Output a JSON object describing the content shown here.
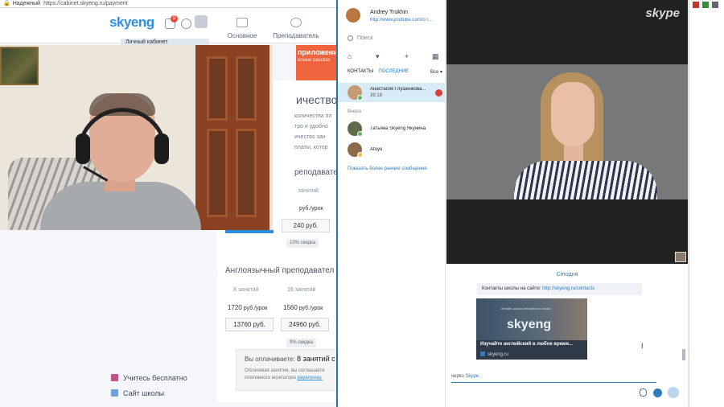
{
  "browser": {
    "secure_label": "Надежный",
    "url": "https://cabinet.skyeng.ru/payment",
    "logo": "skyeng",
    "notif_count": "9",
    "nav": [
      {
        "label": "Основное",
        "icon": "home-icon"
      },
      {
        "label": "Преподаватель",
        "icon": "teacher-icon"
      }
    ],
    "sidebar_active": "Личный кабинет",
    "promo_title": "приложени",
    "promo_sub": "есные рассказ",
    "section_title": "ичество з",
    "desc_lines": [
      "количества пл",
      "тро и удобно",
      "ичество зан",
      "платы, котор"
    ],
    "subhead1": "реподавател",
    "col_head1": "занятий",
    "rate1": "руб./урок",
    "price1": "240 руб.",
    "discount1": "10% скидка",
    "subhead2": "Англоязычный преподавател",
    "cols2": [
      "8 занятий",
      "16 занятий"
    ],
    "rates2": [
      {
        "num": "1720",
        "unit": " руб./урок"
      },
      {
        "num": "1560",
        "unit": " руб./урок"
      }
    ],
    "prices2": [
      "13760 руб.",
      "24960 руб."
    ],
    "discount2": "9% скидка",
    "pay_label": "Вы оплачиваете:",
    "pay_value": "8 занятий с",
    "pay_note1": "Оплачивая занятия, вы соглашаете",
    "pay_note2_pre": "платежного агрегатора ",
    "pay_note2_link": "payanyway.",
    "links": [
      {
        "label": "Учитесь бесплатно",
        "icon": "gift-icon"
      },
      {
        "label": "Сайт школы",
        "icon": "skyeng-s-icon"
      }
    ]
  },
  "skype": {
    "profile_name": "Andrey Trukhin",
    "profile_mood": "http://www.youtube.com/c/T...",
    "search_placeholder": "Поиск",
    "tab_contacts": "КОНТАКТЫ",
    "tab_recent": "ПОСЛЕДНИЕ",
    "filter_all": "Все ▾",
    "section_yesterday": "Вчера",
    "contacts": [
      {
        "name": "Анастасия Глушенкова...",
        "time": "39:19",
        "selected": true
      },
      {
        "name": "Татьяна Skyeng Якунина",
        "time": ""
      },
      {
        "name": "Atoyo",
        "time": ""
      }
    ],
    "show_earlier": "Показать более ранние сообщения",
    "brand": "skype",
    "today_label": "Сегодня",
    "message_pre": "Контакты школы на сайте: ",
    "message_link": "http://skyeng.ru/contacts",
    "preview_logo": "skyeng",
    "preview_caption": "Онлайн-школа английского языка",
    "preview_title": "Изучайте английский в любое время...",
    "preview_site": "skyeng.ru",
    "via_pre": "через ",
    "via_link": "Skype"
  },
  "colors": {
    "skyeng_blue": "#2f8ee0",
    "skype_blue": "#2f7ac0",
    "promo_orange": "#f0643d",
    "online_green": "#5cb85c"
  }
}
